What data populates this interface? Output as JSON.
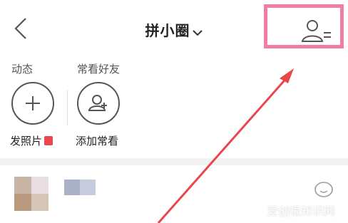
{
  "header": {
    "title": "拼小圈",
    "back_icon": "chevron-left-icon",
    "caret_icon": "chevron-down-icon",
    "contacts_icon": "contacts-list-icon"
  },
  "sections": {
    "dynamic_label": "动态",
    "frequent_label": "常看好友"
  },
  "actions": {
    "photo_label": "发照片",
    "add_label": "添加常看"
  },
  "annotation": {
    "highlight_color": "#f07ca7",
    "arrow_color": "#e8474b"
  },
  "watermark": "爱创根知识网"
}
